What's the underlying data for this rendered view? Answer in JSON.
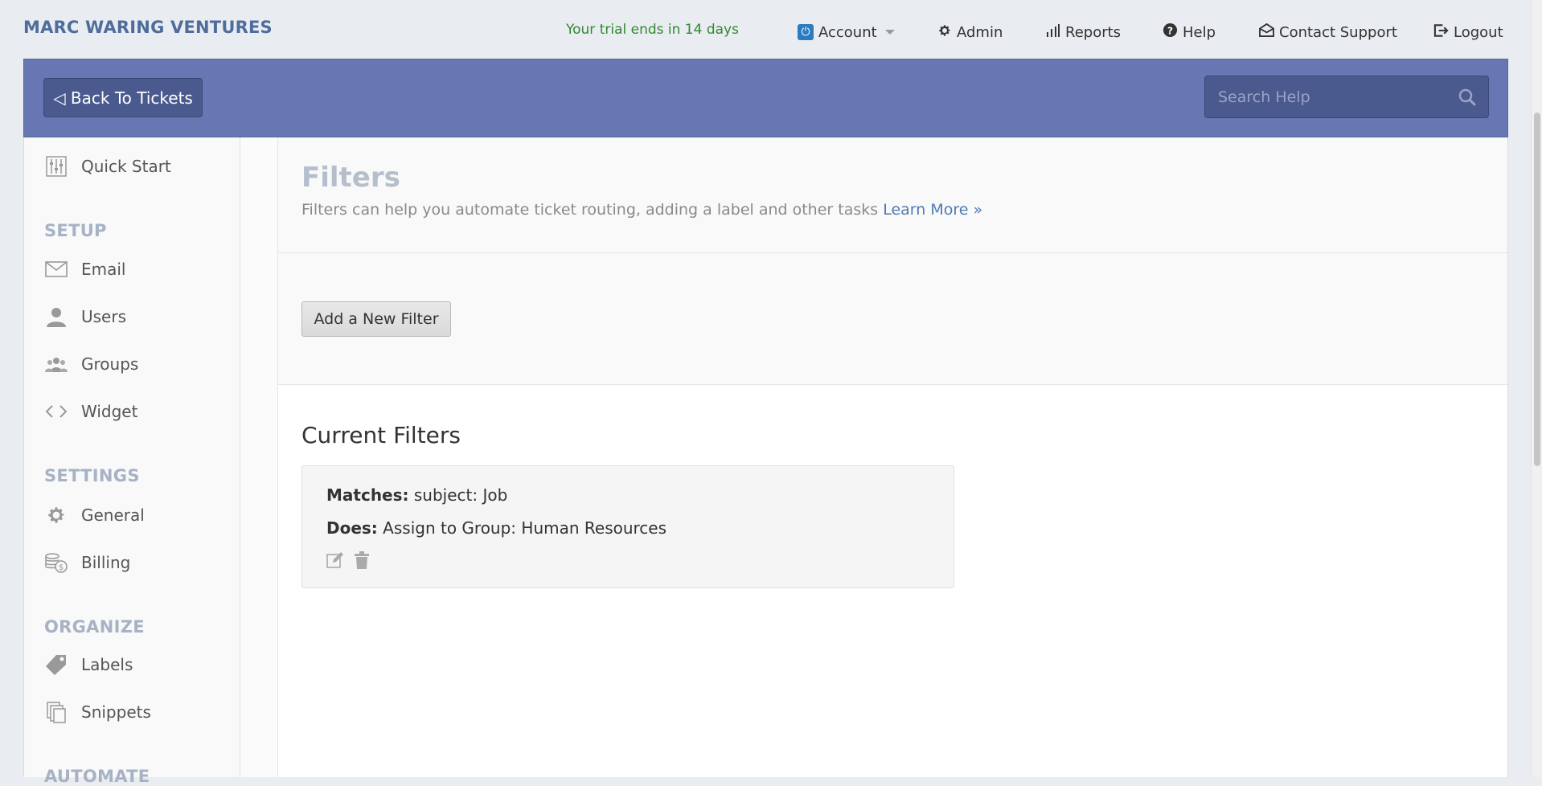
{
  "brand": "MARC WARING VENTURES",
  "trial_notice": "Your trial ends in 14 days",
  "topnav": {
    "account": "Account",
    "admin": "Admin",
    "reports": "Reports",
    "help": "Help",
    "contact": "Contact Support",
    "logout": "Logout"
  },
  "header": {
    "back_label": "◁ Back To Tickets",
    "search_placeholder": "Search Help"
  },
  "sidebar": {
    "quick_start": "Quick Start",
    "setup_heading": "SETUP",
    "setup_items": [
      "Email",
      "Users",
      "Groups",
      "Widget"
    ],
    "settings_heading": "SETTINGS",
    "settings_items": [
      "General",
      "Billing"
    ],
    "organize_heading": "ORGANIZE",
    "organize_items": [
      "Labels",
      "Snippets"
    ],
    "automate_heading": "AUTOMATE"
  },
  "main": {
    "title": "Filters",
    "description": "Filters can help you automate ticket routing, adding a label and other tasks",
    "learn_more": "Learn More »",
    "add_filter_label": "Add a New Filter",
    "current_filters_title": "Current Filters",
    "filters": [
      {
        "matches_label": "Matches:",
        "matches_value": "subject: Job",
        "does_label": "Does:",
        "does_value": "Assign to Group: Human Resources"
      }
    ]
  },
  "colors": {
    "band": "#6677b3",
    "brand": "#4e6d9c",
    "trial": "#2f8a2f",
    "link": "#4e7bb4"
  }
}
